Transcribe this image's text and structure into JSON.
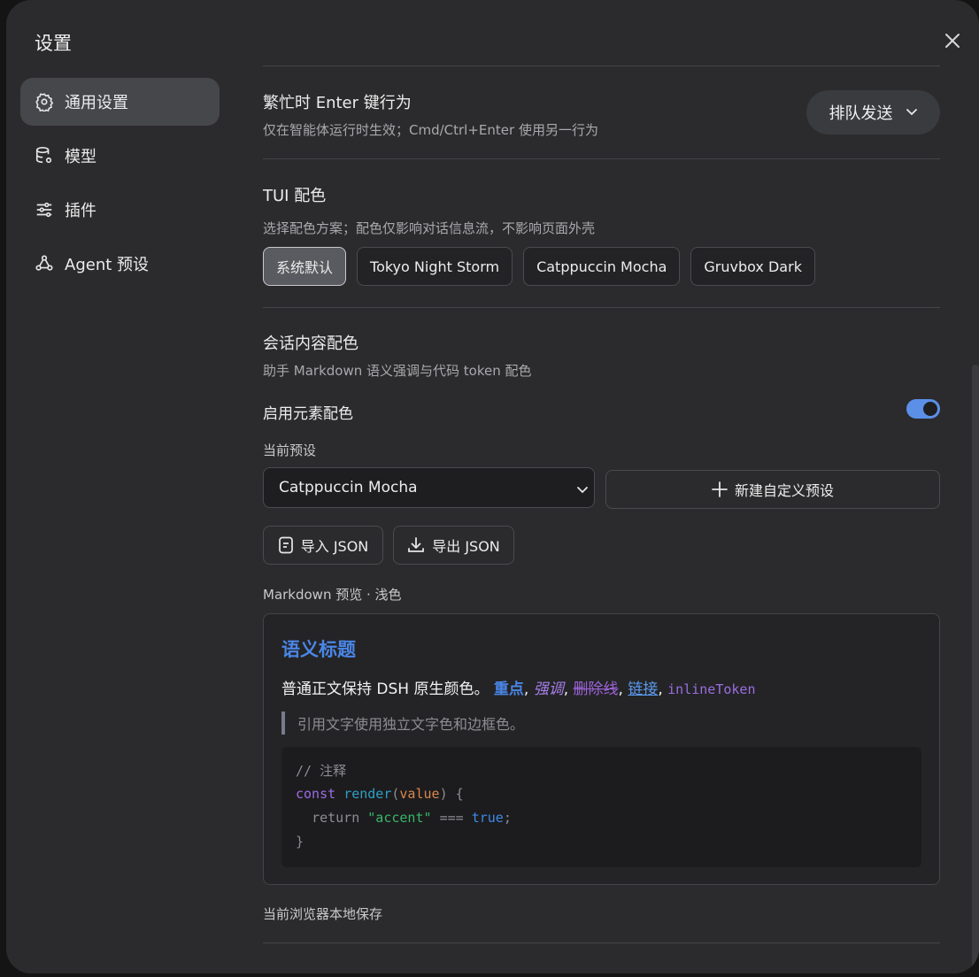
{
  "dialog": {
    "title": "设置"
  },
  "sidebar": {
    "items": [
      {
        "label": "通用设置",
        "icon": "gear-icon",
        "active": true
      },
      {
        "label": "模型",
        "icon": "database-icon",
        "active": false
      },
      {
        "label": "插件",
        "icon": "sliders-icon",
        "active": false
      },
      {
        "label": "Agent 预设",
        "icon": "agent-icon",
        "active": false
      }
    ]
  },
  "busy_enter": {
    "title": "繁忙时 Enter 键行为",
    "description": "仅在智能体运行时生效；Cmd/Ctrl+Enter 使用另一行为",
    "selected": "排队发送"
  },
  "tui_theme": {
    "title": "TUI 配色",
    "description": "选择配色方案；配色仅影响对话信息流，不影响页面外壳",
    "options": [
      "系统默认",
      "Tokyo Night Storm",
      "Catppuccin Mocha",
      "Gruvbox Dark"
    ],
    "active_index": 0
  },
  "session_colors": {
    "title": "会话内容配色",
    "description": "助手 Markdown 语义强调与代码 token 配色",
    "toggle_label": "启用元素配色",
    "toggle_on": true,
    "preset_label": "当前预设",
    "preset_value": "Catppuccin Mocha",
    "new_preset_button": "新建自定义预设",
    "import_button": "导入 JSON",
    "export_button": "导出 JSON"
  },
  "preview": {
    "label": "Markdown 预览 · 浅色",
    "heading": "语义标题",
    "body_text": "普通正文保持 DSH 原生颜色。",
    "strong": "重点",
    "emphasis": "强调",
    "strike": "删除线",
    "link": "链接",
    "inline_token": "inlineToken",
    "sep": ", ",
    "quote": "引用文字使用独立文字色和边框色。",
    "code": {
      "comment": "// 注释",
      "kw_const": "const",
      "fn_name": "render",
      "paren_open": "(",
      "param": "value",
      "paren_close": ")",
      "brace_open": "{",
      "kw_return": "return",
      "string": "\"accent\"",
      "op": "===",
      "bool": "true",
      "semi": ";",
      "brace_close": "}"
    }
  },
  "footer_note": "当前浏览器本地保存",
  "colors": {
    "accent_blue": "#4a86e8",
    "toggle_on": "#5b8fe8",
    "panel_bg": "#2b2b2d"
  }
}
